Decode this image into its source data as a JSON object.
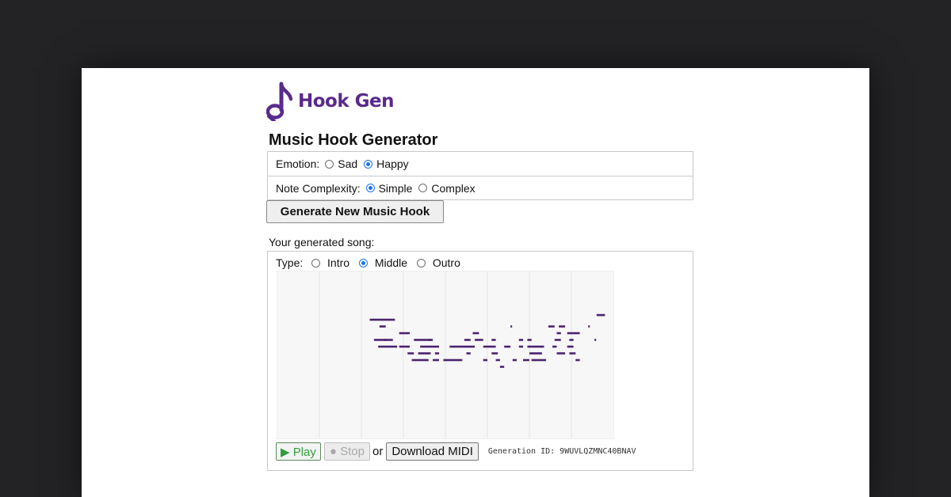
{
  "app": {
    "name": "Hook Gen",
    "brand_color": "#5a2a8c"
  },
  "page": {
    "title": "Music Hook Generator"
  },
  "emotion": {
    "label": "Emotion:",
    "options": [
      {
        "label": "Sad",
        "selected": false
      },
      {
        "label": "Happy",
        "selected": true
      }
    ]
  },
  "complexity": {
    "label": "Note Complexity:",
    "options": [
      {
        "label": "Simple",
        "selected": true
      },
      {
        "label": "Complex",
        "selected": false
      }
    ]
  },
  "generate_button": "Generate New Music Hook",
  "song": {
    "label": "Your generated song:",
    "type": {
      "label": "Type:",
      "options": [
        {
          "label": "Intro",
          "selected": false
        },
        {
          "label": "Middle",
          "selected": true
        },
        {
          "label": "Outro",
          "selected": false
        }
      ]
    }
  },
  "controls": {
    "play_label": "▶ Play",
    "stop_label": "● Stop",
    "or_text": "or",
    "midi_label": "Download MIDI",
    "generation_id": "Generation ID: 9WUVLQZMNC40BNAV"
  },
  "pianoroll": {
    "note_color": "#4b2370",
    "bars": 8,
    "notes": [
      [
        2.2,
        0,
        0.45
      ],
      [
        2.43,
        -1,
        0.15
      ],
      [
        2.65,
        0,
        0.15
      ],
      [
        2.9,
        -2,
        0.25
      ],
      [
        2.3,
        -3,
        0.3
      ],
      [
        2.55,
        -3,
        0.2
      ],
      [
        2.4,
        -4,
        0.45
      ],
      [
        2.9,
        -4,
        0.25
      ],
      [
        3.25,
        -3,
        0.4
      ],
      [
        3.6,
        -3,
        0.1
      ],
      [
        3.4,
        -4,
        0.25
      ],
      [
        3.65,
        -4,
        0.2
      ],
      [
        3.1,
        -5,
        0.15
      ],
      [
        3.35,
        -5,
        0.3
      ],
      [
        3.75,
        -5,
        0.1
      ],
      [
        3.2,
        -6,
        0.4
      ],
      [
        3.7,
        -6,
        0.15
      ],
      [
        3.95,
        -6,
        0.45
      ],
      [
        4.1,
        -4,
        0.6
      ],
      [
        4.5,
        -5,
        0.1
      ],
      [
        4.65,
        -2,
        0.15
      ],
      [
        4.45,
        -3,
        0.15
      ],
      [
        4.7,
        -3,
        0.2
      ],
      [
        5.1,
        -3,
        0.1
      ],
      [
        4.9,
        -4,
        0.3
      ],
      [
        5.4,
        -4,
        0.15
      ],
      [
        4.9,
        -6,
        0.1
      ],
      [
        5.1,
        -5,
        0.15
      ],
      [
        5.2,
        -6,
        0.1
      ],
      [
        5.3,
        -7,
        0.1
      ],
      [
        5.55,
        -1,
        0.04
      ],
      [
        5.6,
        -6,
        0.1
      ],
      [
        5.75,
        -3,
        0.1
      ],
      [
        5.95,
        -3,
        0.1
      ],
      [
        5.75,
        -4,
        0.1
      ],
      [
        5.95,
        -4,
        0.1
      ],
      [
        6.05,
        -4,
        0.3
      ],
      [
        5.85,
        -6,
        0.15
      ],
      [
        6.05,
        -6,
        0.35
      ],
      [
        6.0,
        -5,
        0.3
      ],
      [
        6.45,
        -1,
        0.15
      ],
      [
        6.7,
        -1,
        0.15
      ],
      [
        6.65,
        -2,
        0.1
      ],
      [
        6.9,
        -2,
        0.3
      ],
      [
        6.6,
        -3,
        0.15
      ],
      [
        6.95,
        -3,
        0.1
      ],
      [
        6.55,
        -4,
        0.1
      ],
      [
        6.9,
        -4,
        0.15
      ],
      [
        6.65,
        -5,
        0.2
      ],
      [
        6.95,
        -5,
        0.15
      ],
      [
        7.1,
        -6,
        0.1
      ],
      [
        7.4,
        -1,
        0.04
      ],
      [
        7.6,
        0.7,
        0.2
      ],
      [
        7.55,
        -3,
        0.04
      ]
    ]
  }
}
